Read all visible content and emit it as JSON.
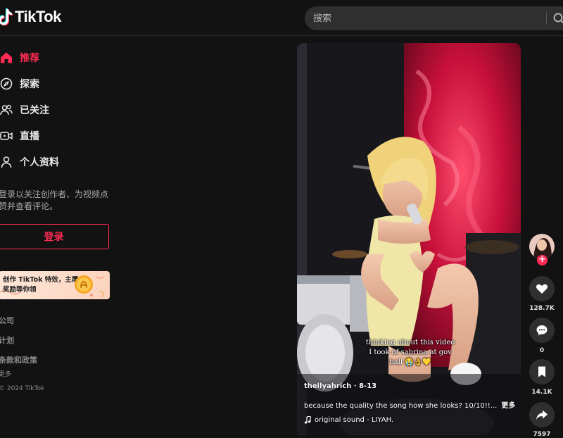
{
  "brand": {
    "name": "TikTok"
  },
  "search": {
    "placeholder": "搜索"
  },
  "sidebar": {
    "nav": [
      {
        "label": "推荐",
        "icon": "home-icon",
        "active": true
      },
      {
        "label": "探索",
        "icon": "compass-icon",
        "active": false
      },
      {
        "label": "已关注",
        "icon": "following-icon",
        "active": false
      },
      {
        "label": "直播",
        "icon": "live-icon",
        "active": false
      },
      {
        "label": "个人资料",
        "icon": "profile-icon",
        "active": false
      }
    ],
    "login_hint": "登录以关注创作者、为视频点赞并查看评论。",
    "login_button": "登录",
    "promo": {
      "text": "创作 TikTok 特效，主厚奖励等你领"
    },
    "footer": {
      "company": "公司",
      "program": "计划",
      "terms": "条款和政策",
      "more": "更多",
      "copyright": "© 2024 TikTok"
    }
  },
  "video": {
    "caption_overlay": "thinking about this video I took of sabrina at gov ball 😭👌💛",
    "author": "thellyahrich · 8-13",
    "description": "because the quality the song how she looks? 10/10!!...",
    "more": "更多",
    "sound": "original sound - LIYAH."
  },
  "actions": {
    "likes": "128.7K",
    "comments": "0",
    "saves": "14.1K",
    "shares": "7597"
  },
  "colors": {
    "accent": "#fe2c55",
    "background": "#121212"
  }
}
